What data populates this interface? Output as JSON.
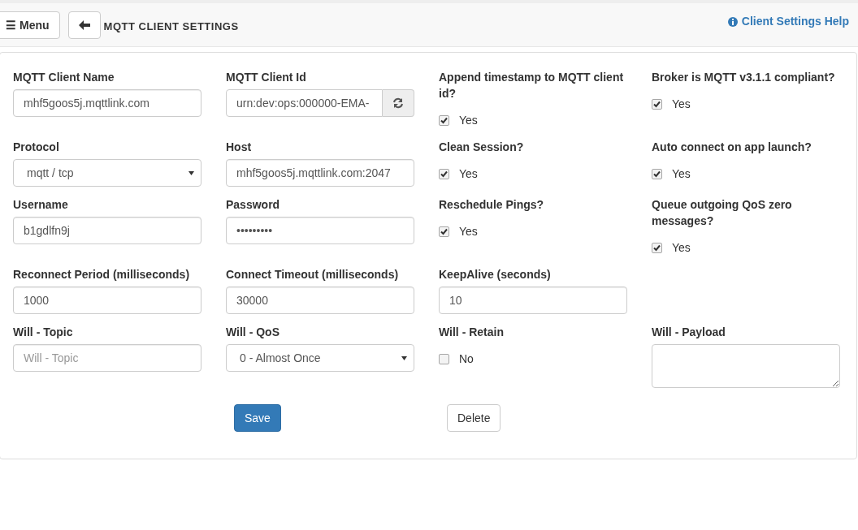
{
  "header": {
    "menu_button": {
      "icon": "☰",
      "label": "Menu"
    },
    "title": "MQTT CLIENT SETTINGS",
    "help_link": "Client Settings Help"
  },
  "fields": [
    {
      "kind": "text",
      "label": "MQTT Client Name",
      "value": "mhf5goos5j.mqttlink.com"
    },
    {
      "kind": "input_group",
      "label": "MQTT Client Id",
      "value": "urn:dev:ops:000000-EMA-"
    },
    {
      "kind": "checkbox",
      "label": "Append timestamp to MQTT client id?",
      "checked": true,
      "option": "Yes"
    },
    {
      "kind": "checkbox",
      "label": "Broker is MQTT v3.1.1 compliant?",
      "checked": true,
      "option": "Yes"
    },
    {
      "kind": "select",
      "label": "Protocol",
      "value": "mqtt / tcp"
    },
    {
      "kind": "text",
      "label": "Host",
      "value": "mhf5goos5j.mqttlink.com:2047"
    },
    {
      "kind": "checkbox",
      "label": "Clean Session?",
      "checked": true,
      "option": "Yes"
    },
    {
      "kind": "checkbox",
      "label": "Auto connect on app launch?",
      "checked": true,
      "option": "Yes"
    },
    {
      "kind": "text",
      "label": "Username",
      "value": "b1gdlfn9j"
    },
    {
      "kind": "text",
      "label": "Password",
      "value": "•••••••••"
    },
    {
      "kind": "checkbox",
      "label": "Reschedule Pings?",
      "checked": true,
      "option": "Yes"
    },
    {
      "kind": "checkbox",
      "label": "Queue outgoing QoS zero messages?",
      "checked": true,
      "option": "Yes"
    },
    {
      "kind": "text",
      "label": "Reconnect Period (milliseconds)",
      "value": "1000"
    },
    {
      "kind": "text",
      "label": "Connect Timeout (milliseconds)",
      "value": "30000"
    },
    {
      "kind": "text",
      "label": "KeepAlive (seconds)",
      "value": "10"
    },
    {
      "kind": "empty"
    },
    {
      "kind": "text",
      "label": "Will - Topic",
      "placeholder": "Will - Topic"
    },
    {
      "kind": "select",
      "label": "Will - QoS",
      "value": "0 - Almost Once"
    },
    {
      "kind": "checkbox",
      "label": "Will - Retain",
      "checked": false,
      "option": "No"
    },
    {
      "kind": "textarea",
      "label": "Will - Payload"
    }
  ],
  "buttons": [
    {
      "kind": "primary",
      "label": "Save"
    },
    {
      "kind": "default",
      "label": "Delete"
    }
  ]
}
